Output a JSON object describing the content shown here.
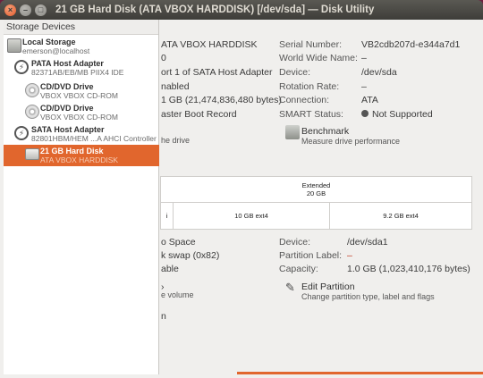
{
  "window": {
    "title": "21 GB Hard Disk (ATA VBOX HARDDISK) [/dev/sda] — Disk Utility",
    "close_glyph": "×",
    "min_glyph": "–",
    "max_glyph": "□"
  },
  "sidebar": {
    "header": "Storage Devices",
    "items": [
      {
        "title": "Local Storage",
        "subtitle": "emerson@localhost",
        "icon": "computer-icon"
      },
      {
        "title": "PATA Host Adapter",
        "subtitle": "82371AB/EB/MB PIIX4 IDE",
        "icon": "adapter-icon"
      },
      {
        "title": "CD/DVD Drive",
        "subtitle": "VBOX VBOX CD-ROM",
        "icon": "optical-disc-icon"
      },
      {
        "title": "CD/DVD Drive",
        "subtitle": "VBOX VBOX CD-ROM",
        "icon": "optical-disc-icon"
      },
      {
        "title": "SATA Host Adapter",
        "subtitle": "82801HBM/HEM ...A AHCI Controller",
        "icon": "adapter-icon"
      },
      {
        "title": "21 GB Hard Disk",
        "subtitle": "ATA VBOX HARDDISK",
        "icon": "hard-disk-icon",
        "selected": true
      }
    ]
  },
  "drive": {
    "model": "ATA VBOX HARDDISK",
    "firmware": "0",
    "location": "ort 1 of SATA Host Adapter",
    "write_cache": "nabled",
    "capacity": "1 GB (21,474,836,480 bytes)",
    "partitioning": "aster Boot Record",
    "serial_label": "Serial Number:",
    "serial_value": "VB2cdb207d-e344a7d1",
    "wwn_label": "World Wide Name:",
    "wwn_value": "–",
    "device_label": "Device:",
    "device_value": "/dev/sda",
    "rotation_label": "Rotation Rate:",
    "rotation_value": "–",
    "connection_label": "Connection:",
    "connection_value": "ATA",
    "smart_label": "SMART Status:",
    "smart_value": "Not Supported",
    "format_sub": "he drive"
  },
  "actions": {
    "benchmark_title": "Benchmark",
    "benchmark_sub": "Measure drive performance",
    "edit_title": "Edit Partition",
    "edit_sub": "Change partition type, label and flags",
    "delete_sub": "e volume"
  },
  "volumes": {
    "extended_name": "Extended",
    "extended_size": "20 GB",
    "part_left_fragment": "i",
    "part_mid": "10 GB ext4",
    "part_right": "9.2 GB ext4"
  },
  "volume_detail": {
    "usage": "o Space",
    "type": "k swap (0x82)",
    "flag": "able",
    "device_label": "Device:",
    "device_value": "/dev/sda1",
    "partlabel_label": "Partition Label:",
    "partlabel_value": "–",
    "capacity_label": "Capacity:",
    "capacity_value": "1.0 GB (1,023,410,176 bytes)",
    "misc": "n"
  },
  "colors": {
    "accent": "#e1662d",
    "titlebar": "#3e3d39"
  }
}
